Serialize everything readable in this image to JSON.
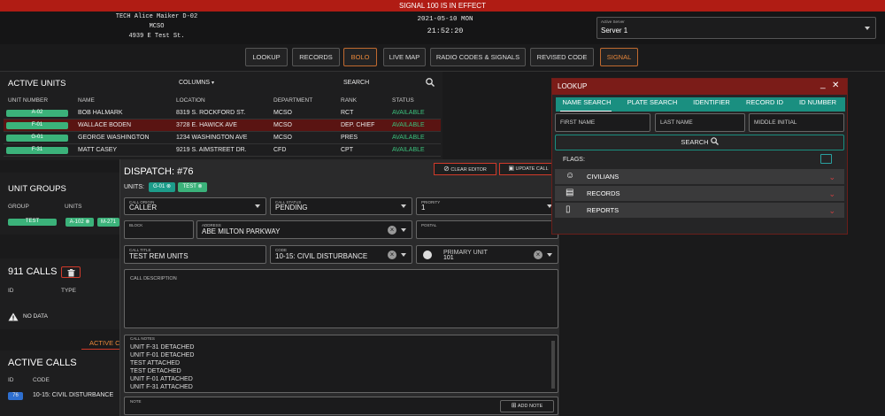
{
  "signal": {
    "text": "SIGNAL 100 IS IN EFFECT"
  },
  "header": {
    "user": "TECH Alice Maiker D-02",
    "agency": "MCSO",
    "address": "4939 E Test St.",
    "date": "2021-05-10 MON",
    "time": "21:52:20",
    "server_label": "Active Server",
    "server_value": "Server 1"
  },
  "nav": {
    "lookup": "LOOKUP",
    "records": "RECORDS",
    "bolo": "BOLO",
    "live_map": "LIVE MAP",
    "radio": "RADIO CODES & SIGNALS",
    "revised": "REVISED CODE",
    "signal": "SIGNAL"
  },
  "active_units": {
    "title": "ACTIVE UNITS",
    "columns_label": "COLUMNS",
    "search_label": "SEARCH",
    "headers": [
      "UNIT NUMBER",
      "NAME",
      "LOCATION",
      "DEPARTMENT",
      "RANK",
      "STATUS"
    ],
    "rows": [
      {
        "unit": "A-02",
        "name": "BOB HALMARK",
        "location": "8319 S. ROCKFORD ST.",
        "dept": "MCSO",
        "rank": "RCT",
        "status": "AVAILABLE"
      },
      {
        "unit": "F-01",
        "name": "WALLACE BODEN",
        "location": "3728 E. HAWICK AVE",
        "dept": "MCSO",
        "rank": "DEP. CHIEF",
        "status": "AVAILABLE"
      },
      {
        "unit": "G-01",
        "name": "GEORGE WASHINGTON",
        "location": "1234 WASHINGTON AVE",
        "dept": "MCSO",
        "rank": "PRES",
        "status": "AVAILABLE"
      },
      {
        "unit": "F-31",
        "name": "MATT CASEY",
        "location": "9219 S. AIMSTREET DR.",
        "dept": "CFD",
        "rank": "CPT",
        "status": "AVAILABLE"
      }
    ]
  },
  "unit_groups": {
    "title": "UNIT GROUPS",
    "h_group": "GROUP",
    "h_units": "UNITS",
    "group": "TEST",
    "units": [
      "A-102",
      "M-271"
    ]
  },
  "calls911": {
    "title": "911 CALLS",
    "h_id": "ID",
    "h_type": "TYPE",
    "no_data": "NO DATA"
  },
  "bottom_tab": "ACTIVE C",
  "active_calls": {
    "title": "ACTIVE CALLS",
    "h_id": "ID",
    "h_code": "CODE",
    "id": "76",
    "code": "10-15: CIVIL DISTURBANCE"
  },
  "dispatch": {
    "title": "DISPATCH: #76",
    "units_label": "UNITS:",
    "units": [
      "G-01",
      "TEST"
    ],
    "clear_editor": "CLEAR EDITOR",
    "update_call": "UPDATE CALL",
    "call_origin_label": "CALL ORIGIN",
    "call_origin": "CALLER",
    "call_status_label": "CALL STATUS",
    "call_status": "PENDING",
    "priority_label": "PRIORITY",
    "priority": "1",
    "block_label": "BLOCK",
    "address_label": "ADDRESS",
    "address": "ABE MILTON PARKWAY",
    "postal_label": "POSTAL",
    "call_title_label": "CALL TITLE",
    "call_title": "TEST REM UNITS",
    "code_label": "CODE",
    "code": "10-15: CIVIL DISTURBANCE",
    "primary_unit_label": "PRIMARY UNIT",
    "primary_unit": "101",
    "description_label": "CALL DESCRIPTION",
    "notes_label": "CALL NOTES",
    "notes": [
      "UNIT F-31 DETACHED",
      "UNIT F-01 DETACHED",
      "TEST ATTACHED",
      "TEST DETACHED",
      "UNIT F-01 ATTACHED",
      "UNIT F-31 ATTACHED"
    ],
    "note_label": "NOTE",
    "add_note": "ADD NOTE"
  },
  "lookup": {
    "title": "LOOKUP",
    "tabs": [
      "NAME SEARCH",
      "PLATE SEARCH",
      "IDENTIFIER",
      "RECORD ID",
      "ID NUMBER"
    ],
    "first_name": "FIRST NAME",
    "last_name": "LAST NAME",
    "middle_initial": "MIDDLE INITIAL",
    "search": "SEARCH",
    "flags": "FLAGS:",
    "civilians": "CIVILIANS",
    "records": "RECORDS",
    "reports": "REPORTS"
  },
  "colors": {
    "accent_red": "#b01c14",
    "teal": "#1a8f80",
    "green_badge": "#3bb27a",
    "orange": "#e8873a"
  }
}
